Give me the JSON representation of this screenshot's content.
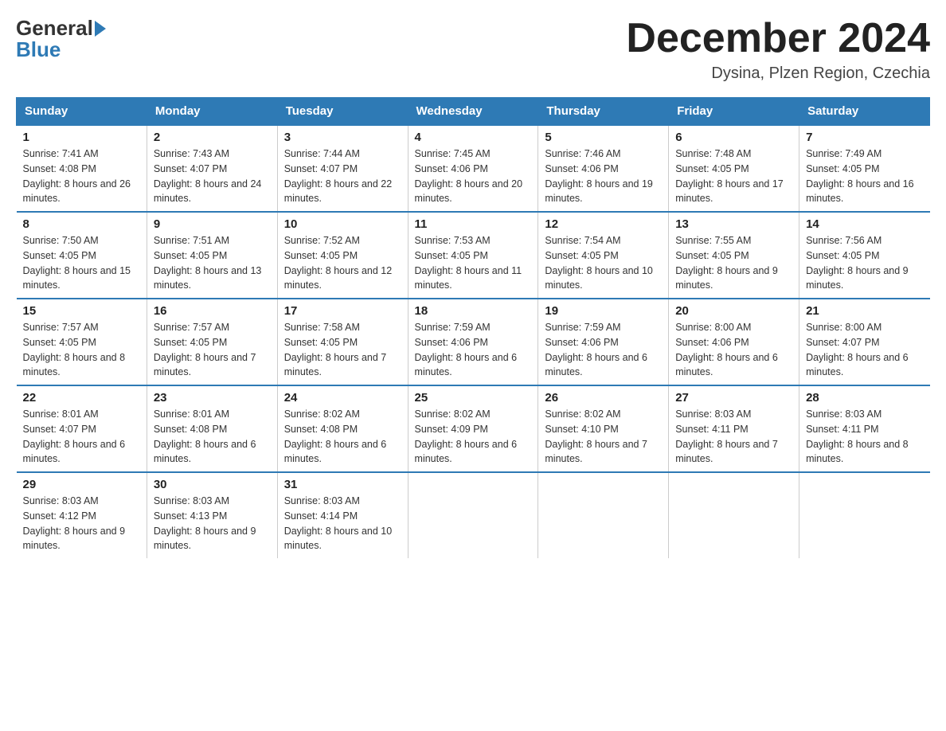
{
  "logo": {
    "general": "General",
    "blue": "Blue"
  },
  "title": "December 2024",
  "location": "Dysina, Plzen Region, Czechia",
  "days_of_week": [
    "Sunday",
    "Monday",
    "Tuesday",
    "Wednesday",
    "Thursday",
    "Friday",
    "Saturday"
  ],
  "weeks": [
    [
      {
        "day": "1",
        "sunrise": "7:41 AM",
        "sunset": "4:08 PM",
        "daylight": "8 hours and 26 minutes."
      },
      {
        "day": "2",
        "sunrise": "7:43 AM",
        "sunset": "4:07 PM",
        "daylight": "8 hours and 24 minutes."
      },
      {
        "day": "3",
        "sunrise": "7:44 AM",
        "sunset": "4:07 PM",
        "daylight": "8 hours and 22 minutes."
      },
      {
        "day": "4",
        "sunrise": "7:45 AM",
        "sunset": "4:06 PM",
        "daylight": "8 hours and 20 minutes."
      },
      {
        "day": "5",
        "sunrise": "7:46 AM",
        "sunset": "4:06 PM",
        "daylight": "8 hours and 19 minutes."
      },
      {
        "day": "6",
        "sunrise": "7:48 AM",
        "sunset": "4:05 PM",
        "daylight": "8 hours and 17 minutes."
      },
      {
        "day": "7",
        "sunrise": "7:49 AM",
        "sunset": "4:05 PM",
        "daylight": "8 hours and 16 minutes."
      }
    ],
    [
      {
        "day": "8",
        "sunrise": "7:50 AM",
        "sunset": "4:05 PM",
        "daylight": "8 hours and 15 minutes."
      },
      {
        "day": "9",
        "sunrise": "7:51 AM",
        "sunset": "4:05 PM",
        "daylight": "8 hours and 13 minutes."
      },
      {
        "day": "10",
        "sunrise": "7:52 AM",
        "sunset": "4:05 PM",
        "daylight": "8 hours and 12 minutes."
      },
      {
        "day": "11",
        "sunrise": "7:53 AM",
        "sunset": "4:05 PM",
        "daylight": "8 hours and 11 minutes."
      },
      {
        "day": "12",
        "sunrise": "7:54 AM",
        "sunset": "4:05 PM",
        "daylight": "8 hours and 10 minutes."
      },
      {
        "day": "13",
        "sunrise": "7:55 AM",
        "sunset": "4:05 PM",
        "daylight": "8 hours and 9 minutes."
      },
      {
        "day": "14",
        "sunrise": "7:56 AM",
        "sunset": "4:05 PM",
        "daylight": "8 hours and 9 minutes."
      }
    ],
    [
      {
        "day": "15",
        "sunrise": "7:57 AM",
        "sunset": "4:05 PM",
        "daylight": "8 hours and 8 minutes."
      },
      {
        "day": "16",
        "sunrise": "7:57 AM",
        "sunset": "4:05 PM",
        "daylight": "8 hours and 7 minutes."
      },
      {
        "day": "17",
        "sunrise": "7:58 AM",
        "sunset": "4:05 PM",
        "daylight": "8 hours and 7 minutes."
      },
      {
        "day": "18",
        "sunrise": "7:59 AM",
        "sunset": "4:06 PM",
        "daylight": "8 hours and 6 minutes."
      },
      {
        "day": "19",
        "sunrise": "7:59 AM",
        "sunset": "4:06 PM",
        "daylight": "8 hours and 6 minutes."
      },
      {
        "day": "20",
        "sunrise": "8:00 AM",
        "sunset": "4:06 PM",
        "daylight": "8 hours and 6 minutes."
      },
      {
        "day": "21",
        "sunrise": "8:00 AM",
        "sunset": "4:07 PM",
        "daylight": "8 hours and 6 minutes."
      }
    ],
    [
      {
        "day": "22",
        "sunrise": "8:01 AM",
        "sunset": "4:07 PM",
        "daylight": "8 hours and 6 minutes."
      },
      {
        "day": "23",
        "sunrise": "8:01 AM",
        "sunset": "4:08 PM",
        "daylight": "8 hours and 6 minutes."
      },
      {
        "day": "24",
        "sunrise": "8:02 AM",
        "sunset": "4:08 PM",
        "daylight": "8 hours and 6 minutes."
      },
      {
        "day": "25",
        "sunrise": "8:02 AM",
        "sunset": "4:09 PM",
        "daylight": "8 hours and 6 minutes."
      },
      {
        "day": "26",
        "sunrise": "8:02 AM",
        "sunset": "4:10 PM",
        "daylight": "8 hours and 7 minutes."
      },
      {
        "day": "27",
        "sunrise": "8:03 AM",
        "sunset": "4:11 PM",
        "daylight": "8 hours and 7 minutes."
      },
      {
        "day": "28",
        "sunrise": "8:03 AM",
        "sunset": "4:11 PM",
        "daylight": "8 hours and 8 minutes."
      }
    ],
    [
      {
        "day": "29",
        "sunrise": "8:03 AM",
        "sunset": "4:12 PM",
        "daylight": "8 hours and 9 minutes."
      },
      {
        "day": "30",
        "sunrise": "8:03 AM",
        "sunset": "4:13 PM",
        "daylight": "8 hours and 9 minutes."
      },
      {
        "day": "31",
        "sunrise": "8:03 AM",
        "sunset": "4:14 PM",
        "daylight": "8 hours and 10 minutes."
      },
      null,
      null,
      null,
      null
    ]
  ]
}
